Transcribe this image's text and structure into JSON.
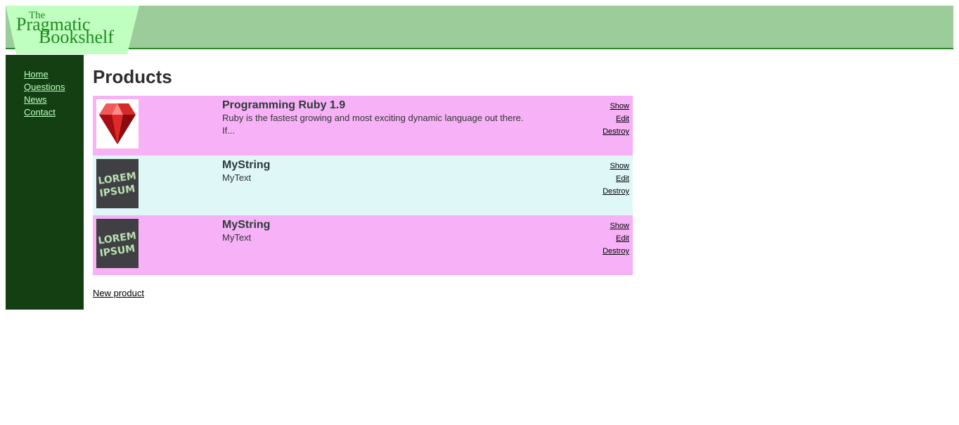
{
  "logo": {
    "line1": "The",
    "line2": "Pragmatic",
    "line3": "Bookshelf"
  },
  "nav": {
    "items": [
      {
        "label": "Home"
      },
      {
        "label": "Questions"
      },
      {
        "label": "News"
      },
      {
        "label": "Contact"
      }
    ]
  },
  "page": {
    "title": "Products",
    "new_product_label": "New product"
  },
  "products": [
    {
      "title": "Programming Ruby 1.9",
      "description": "Ruby is the fastest growing and most exciting dynamic language out there. If...",
      "image": "ruby-gem-image",
      "show_label": "Show",
      "edit_label": "Edit",
      "destroy_label": "Destroy"
    },
    {
      "title": "MyString",
      "description": "MyText",
      "image": "lorem-ipsum-image",
      "show_label": "Show",
      "edit_label": "Edit",
      "destroy_label": "Destroy"
    },
    {
      "title": "MyString",
      "description": "MyText",
      "image": "lorem-ipsum-image",
      "show_label": "Show",
      "edit_label": "Edit",
      "destroy_label": "Destroy"
    }
  ],
  "thumb_text": {
    "line1": "LOREM",
    "line2": "IPSUM"
  },
  "colors": {
    "banner": "#9ccc9a",
    "logo_bg": "#bfffbf",
    "sidebar": "#133f12",
    "nav_link": "#bfffbf",
    "row_odd": "#f7b2f7",
    "row_even": "#dff7f7"
  }
}
